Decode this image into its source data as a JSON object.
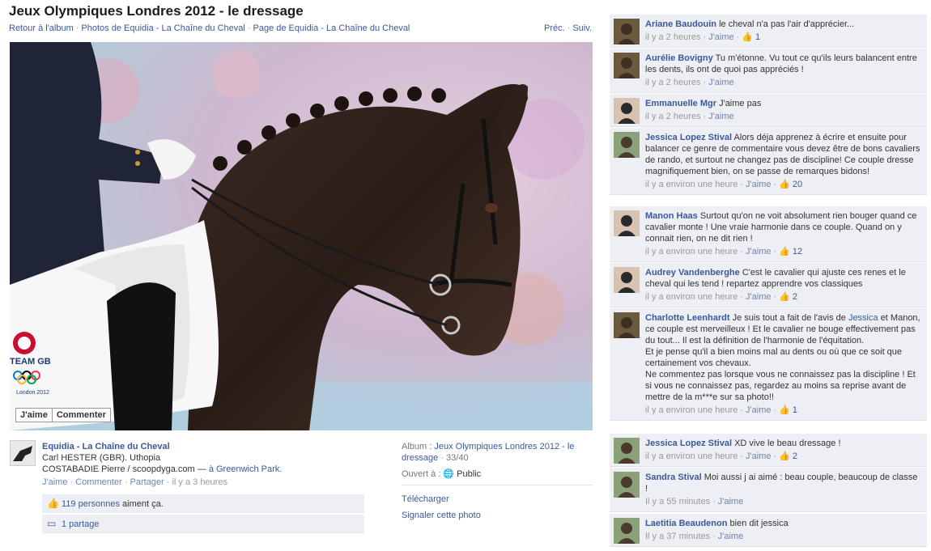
{
  "header": {
    "title": "Jeux Olympiques Londres 2012 - le dressage",
    "back_link": "Retour à l'album",
    "photos_link": "Photos de Equidia - La Chaîne du Cheval",
    "page_link": "Page de Equidia - La Chaîne du Cheval",
    "prev": "Préc.",
    "next": "Suiv."
  },
  "photo": {
    "like_button": "J'aime",
    "comment_button": "Commenter",
    "overlay_text": {
      "team": "TEAM GB",
      "london": "London 2012"
    }
  },
  "owner": {
    "name": "Equidia - La Chaîne du Cheval",
    "caption_line1": "Carl HESTER (GBR). Uthopia",
    "caption_line2_prefix": "COSTABADIE Pierre / scoopdyga.com —",
    "caption_location": "à Greenwich Park.",
    "actions": {
      "like": "J'aime",
      "comment": "Commenter",
      "share": "Partager",
      "time": "il y a 3 heures"
    },
    "likes_count": "119 personnes",
    "likes_suffix": "aiment ça.",
    "shares": "1 partage"
  },
  "album_info": {
    "album_label": "Album :",
    "album_name": "Jeux Olympiques Londres 2012 - le dressage",
    "album_position": "· 33/40",
    "audience_label": "Ouvert à :",
    "audience_value": "Public",
    "download": "Télécharger",
    "report": "Signaler cette photo"
  },
  "comments": [
    {
      "name": "Ariane Baudouin",
      "text": "le cheval n'a pas l'air d'apprécier...",
      "time": "il y a 2 heures",
      "like": "J'aime",
      "likes": "1",
      "avatar": "horse-avatar"
    },
    {
      "name": "Aurélie Bovigny",
      "text": "Tu m'étonne. Vu tout ce qu'ils leurs balancent entre les dents, ils ont de quoi pas appréciés !",
      "time": "il y a 2 heures",
      "like": "J'aime",
      "likes": "",
      "avatar": "horse-avatar"
    },
    {
      "name": "Emmanuelle Mgr",
      "text": "J'aime pas",
      "time": "il y a 2 heures",
      "like": "J'aime",
      "likes": "",
      "avatar": "person-avatar"
    },
    {
      "name": "Jessica Lopez Stival",
      "text": "Alors déja apprenez à écrire et ensuite pour balancer ce genre de commentaire vous devez être de bons cavaliers de rando, et surtout ne changez pas de discipline! Ce couple dresse magnifiquement bien, on se passe de remarques bidons!",
      "time": "il y a environ une heure",
      "like": "J'aime",
      "likes": "20",
      "avatar": "rider-avatar"
    },
    {
      "name": "Manon Haas",
      "text": "Surtout qu'on ne voit absolument rien bouger quand ce cavalier monte ! Une vraie harmonie dans ce couple. Quand on y connait rien, on ne dit rien !",
      "time": "il y a environ une heure",
      "like": "J'aime",
      "likes": "12",
      "avatar": "person-avatar"
    },
    {
      "name": "Audrey Vandenberghe",
      "text": "C'est le cavalier qui ajuste ces renes et le cheval qui les tend ! repartez apprendre vos classiques",
      "time": "il y a environ une heure",
      "like": "J'aime",
      "likes": "2",
      "avatar": "person-avatar"
    },
    {
      "name": "Charlotte Leenhardt",
      "text": "Je suis tout a fait de l'avis de",
      "mention": "Jessica",
      "text2": "et Manon, ce couple est merveilleux ! Et le cavalier ne bouge effectivement pas du tout... Il est la définition de l'harmonie de l'équitation.",
      "text3": "Et je pense qu'il a bien moins mal au dents ou où que ce soit que certainement vos chevaux.",
      "text4": "Ne commentez pas lorsque vous ne connaissez pas la discipline ! Et si vous ne connaissez pas, regardez au moins sa reprise avant de mettre de la m***e sur sa photo!!",
      "time": "il y a environ une heure",
      "like": "J'aime",
      "likes": "1",
      "avatar": "horse-avatar"
    },
    {
      "name": "Jessica Lopez Stival",
      "text": "XD vive le beau dressage !",
      "time": "il y a environ une heure",
      "like": "J'aime",
      "likes": "2",
      "avatar": "rider-avatar"
    },
    {
      "name": "Sandra Stival",
      "text": "Moi aussi j ai aimé : beau couple, beaucoup de classe !",
      "time": "Il y a 55 minutes",
      "like": "J'aime",
      "likes": "",
      "avatar": "rider-avatar"
    },
    {
      "name": "Laetitia Beaudenon",
      "text": "bien dit jessica",
      "time": "Il y a 37 minutes",
      "like": "J'aime",
      "likes": "",
      "avatar": "rider-avatar"
    }
  ],
  "colors": {
    "link": "#3b5998",
    "comment_bg": "#edeff4",
    "muted": "#999999"
  }
}
